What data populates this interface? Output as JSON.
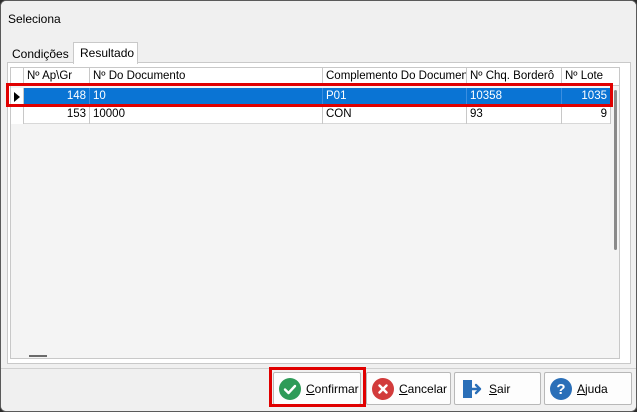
{
  "window": {
    "title": "Seleciona"
  },
  "tabs": [
    {
      "label": "Condições",
      "active": false
    },
    {
      "label": "Resultado",
      "active": true
    }
  ],
  "grid": {
    "columns": [
      "Nº Ap\\Gr",
      "Nº Do Documento",
      "Complemento Do Documento",
      "Nº Chq. Borderô",
      "Nº Lote"
    ],
    "rows": [
      {
        "selected": true,
        "cells": [
          "148",
          "10",
          "P01",
          "10358",
          "1035"
        ]
      },
      {
        "selected": false,
        "cells": [
          "153",
          "10000",
          "CON",
          "93",
          "9"
        ]
      }
    ]
  },
  "buttons": {
    "confirm": {
      "first": "C",
      "rest": "onfirmar",
      "color": "#2e9b58"
    },
    "cancel": {
      "first": "C",
      "rest": "ancelar",
      "color": "#d23b3b"
    },
    "exit": {
      "first": "S",
      "rest": "air",
      "color": "#2a6fb8"
    },
    "help": {
      "first": "A",
      "rest": "juda",
      "color": "#2a6fb8"
    }
  },
  "colors": {
    "selection": "#0a74d4",
    "highlight": "#e00000"
  }
}
